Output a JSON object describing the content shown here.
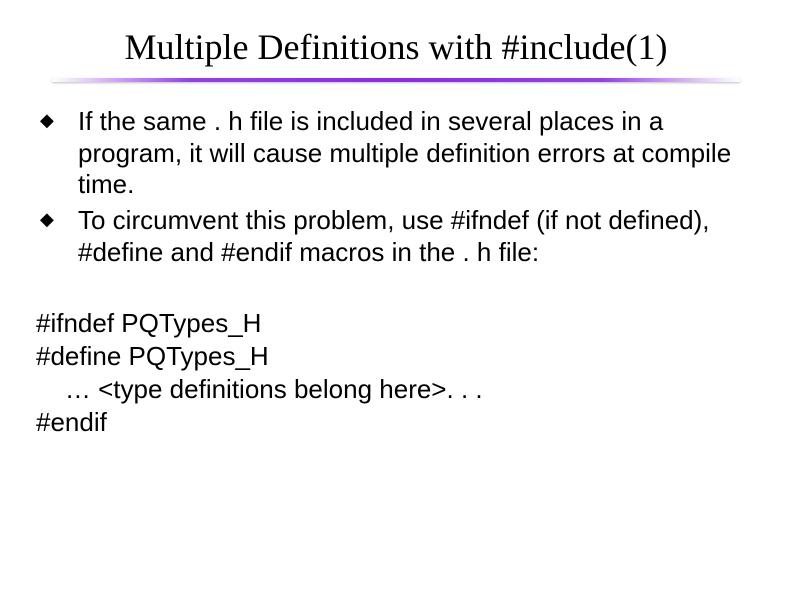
{
  "title": "Multiple Definitions with #include(1)",
  "bullets": [
    "If the same . h file is included in several places in a program, it will cause multiple definition errors at compile time.",
    "To circumvent this problem, use #ifndef (if not defined), #define and #endif macros  in the . h file:"
  ],
  "code": "#ifndef PQTypes_H\n#define PQTypes_H\n    … <type definitions belong here>. . .\n#endif"
}
